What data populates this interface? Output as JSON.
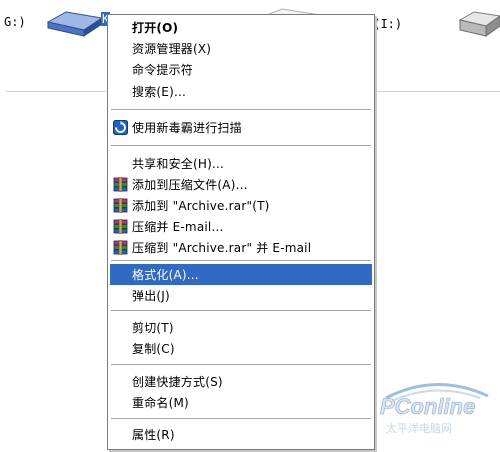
{
  "explorer": {
    "left_drive_label": "G:)",
    "right_drive_label": "本地磁盘 (I:)",
    "selected_drive_caption": "K"
  },
  "menu": {
    "items": [
      {
        "label": "打开(O)",
        "bold": true,
        "icon": null
      },
      {
        "label": "资源管理器(X)",
        "icon": null
      },
      {
        "label": "命令提示符",
        "icon": null
      },
      {
        "label": "搜索(E)...",
        "icon": null
      },
      {
        "label": "使用新毒霸进行扫描",
        "icon": "antivirus-scan-icon"
      },
      {
        "label": "共享和安全(H)...",
        "icon": null
      },
      {
        "label": "添加到压缩文件(A)...",
        "icon": "winrar-icon"
      },
      {
        "label": "添加到 \"Archive.rar\"(T)",
        "icon": "winrar-icon"
      },
      {
        "label": "压缩并 E-mail...",
        "icon": "winrar-icon"
      },
      {
        "label": "压缩到 \"Archive.rar\" 并 E-mail",
        "icon": "winrar-icon"
      },
      {
        "label": "格式化(A)...",
        "icon": null,
        "selected": true
      },
      {
        "label": "弹出(J)",
        "icon": null
      },
      {
        "label": "剪切(T)",
        "icon": null
      },
      {
        "label": "复制(C)",
        "icon": null
      },
      {
        "label": "创建快捷方式(S)",
        "icon": null
      },
      {
        "label": "重命名(M)",
        "icon": null
      },
      {
        "label": "属性(R)",
        "icon": null
      }
    ]
  },
  "watermark": {
    "brand": "PConline",
    "subtitle": "太平洋电脑网"
  },
  "colors": {
    "selection": "#316ac5",
    "menu_border": "#7a7a7a"
  }
}
